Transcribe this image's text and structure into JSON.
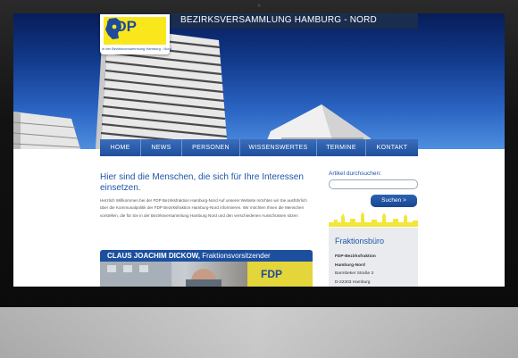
{
  "site": {
    "title": "BEZIRKSVERSAMMLUNG HAMBURG - NORD",
    "logo": {
      "text": "FDP",
      "subtitle": "in der Bezirksversammlung Hamburg - Nord"
    }
  },
  "nav": {
    "items": [
      {
        "label": "HOME"
      },
      {
        "label": "NEWS"
      },
      {
        "label": "PERSONEN"
      },
      {
        "label": "WISSENSWERTES"
      },
      {
        "label": "TERMINE"
      },
      {
        "label": "KONTAKT"
      }
    ]
  },
  "main": {
    "heading": "Hier sind die Menschen, die sich für Ihre Interessen einsetzen.",
    "intro": "Herzlich Willkommen bei der FDP Bezirksfraktion Hamburg-Nord Auf unserer Website möchten wir Sie ausführlich über die Kommunalpolitik der FDP Bezirksfraktion Hamburg-Nord informieren. Wir möchten Ihnen die Menschen vorstellen, die für Sie in der Bezirksversammlung Hamburg Nord und den verschiedenen Ausschüssen sitzen",
    "profile": {
      "name": "CLAUS JOACHIM DICKOW,",
      "role": "Fraktionsvorsitzender"
    }
  },
  "sidebar": {
    "search_label": "Artikel durchsuchen:",
    "search_value": "",
    "search_button": "Suchen >",
    "office": {
      "title": "Fraktionsbüro",
      "line1": "FDP-Bezirksfraktion",
      "line2": "Hamburg-Nord",
      "line3": "Barmbeker Straße 3",
      "line4": "D-22303 Hamburg"
    }
  },
  "colors": {
    "accent": "#1e56a8",
    "nav": "#1f4f9c",
    "logo_yellow": "#f9e71c",
    "device": "#121212"
  }
}
